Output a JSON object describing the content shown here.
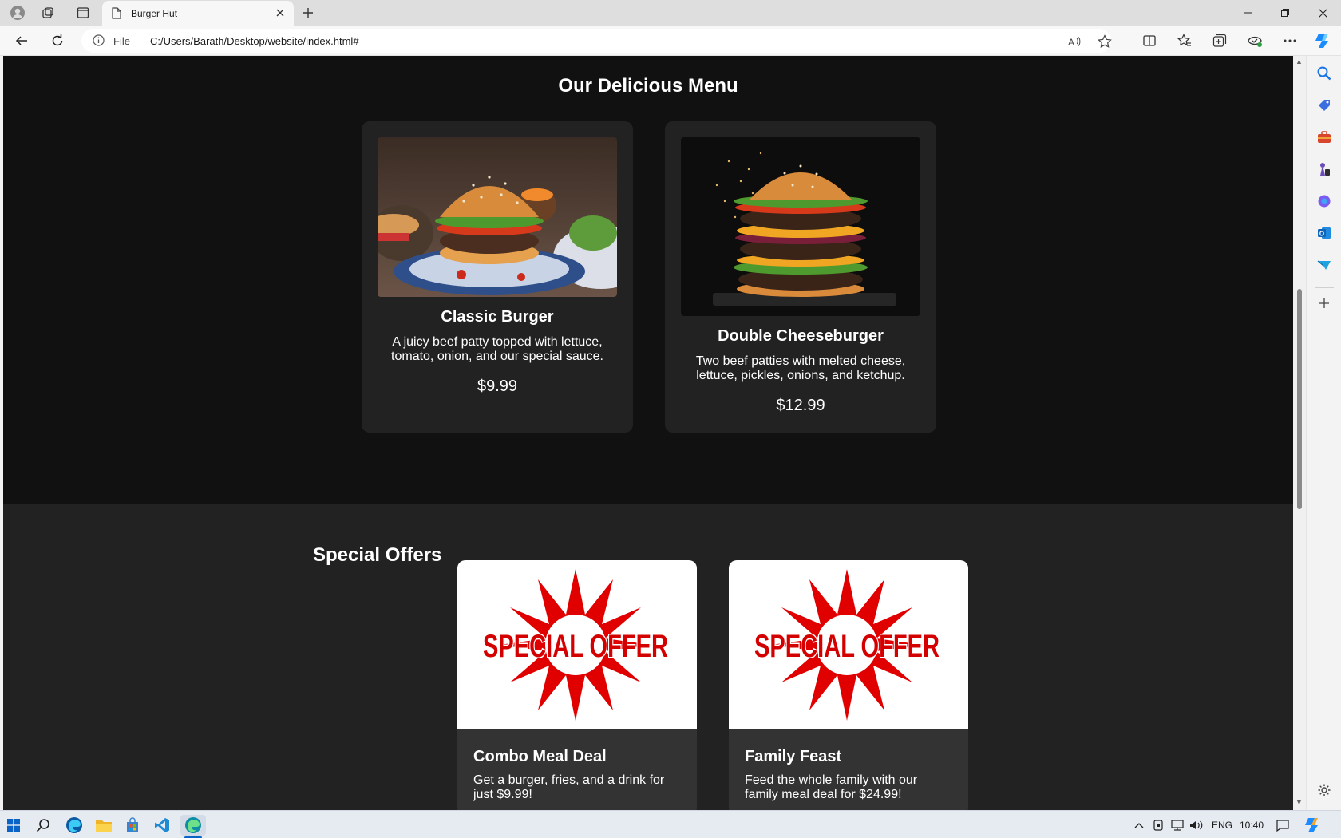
{
  "browser": {
    "tab_title": "Burger Hut",
    "address_prefix": "File",
    "url": "C:/Users/Barath/Desktop/website/index.html#"
  },
  "page": {
    "menu_title": "Our Delicious Menu",
    "menu_items": [
      {
        "name": "Classic Burger",
        "description": "A juicy beef patty topped with lettuce, tomato, onion, and our special sauce.",
        "price": "$9.99"
      },
      {
        "name": "Double Cheeseburger",
        "description": "Two beef patties with melted cheese, lettuce, pickles, onions, and ketchup.",
        "price": "$12.99"
      }
    ],
    "offers_title": "Special Offers",
    "offer_badge_text": "SPECIAL OFFER",
    "offers": [
      {
        "name": "Combo Meal Deal",
        "description": "Get a burger, fries, and a drink for just $9.99!"
      },
      {
        "name": "Family Feast",
        "description": "Feed the whole family with our family meal deal for $24.99!"
      }
    ]
  },
  "taskbar": {
    "language": "ENG",
    "time": "10:40"
  },
  "colors": {
    "page_bg": "#111111",
    "card_bg": "#222222",
    "offer_card_bg": "#333333",
    "offer_badge_red": "#e00000",
    "edge_accent": "#0c59a4"
  }
}
